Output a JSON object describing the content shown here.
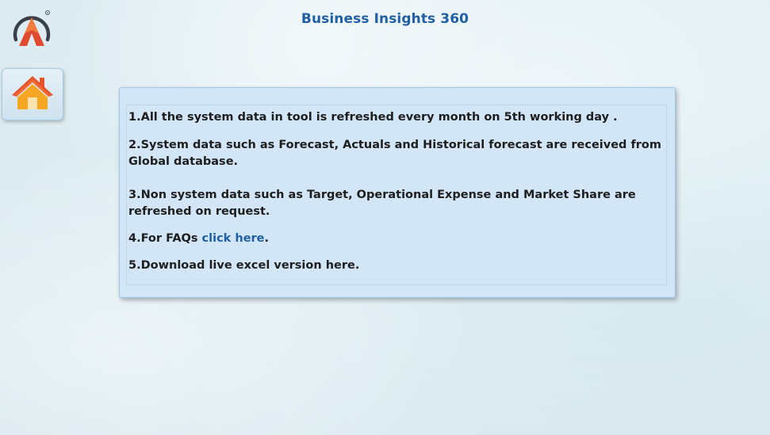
{
  "header": {
    "title": "Business Insights 360",
    "logo_icon": "brand-logo-icon"
  },
  "nav": {
    "home_icon": "home-icon"
  },
  "info": {
    "line1": "1.All the system data in tool is refreshed every month on 5th working day .",
    "line2": "2.System data such as Forecast,  Actuals and Historical forecast are received from Global database.",
    "line3": "3.Non system data such as Target, Operational Expense and Market Share are refreshed on request.",
    "line4_prefix": "4.For FAQs ",
    "line4_link": "click here",
    "line4_suffix": ".",
    "line5": "5.Download live excel version here."
  },
  "colors": {
    "title": "#1f5fa3",
    "link": "#1f5fa3",
    "panel_bg": "#d2e6f8",
    "logo_red": "#e04a2f",
    "logo_dark": "#3a3f4a",
    "house_orange": "#f5a623",
    "house_roof": "#e8542b"
  }
}
